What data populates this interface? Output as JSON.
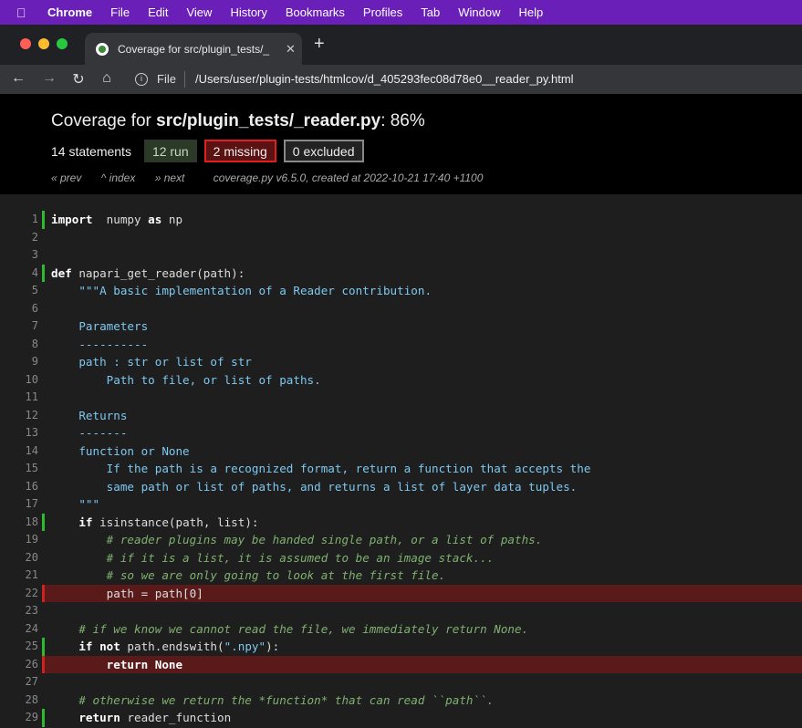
{
  "menubar": {
    "items": [
      "Chrome",
      "File",
      "Edit",
      "View",
      "History",
      "Bookmarks",
      "Profiles",
      "Tab",
      "Window",
      "Help"
    ]
  },
  "tab": {
    "title": "Coverage for src/plugin_tests/_"
  },
  "address": {
    "scheme_label": "File",
    "url": "/Users/user/plugin-tests/htmlcov/d_405293fec08d78e0__reader_py.html"
  },
  "coverage": {
    "title_prefix": "Coverage for ",
    "file": "src/plugin_tests/_reader.py",
    "percent": ": 86%",
    "statements": "14 statements",
    "run": "12 run",
    "missing": "2 missing",
    "excluded": "0 excluded",
    "prev": "« prev",
    "index": "^ index",
    "next": "» next",
    "created": "coverage.py v6.5.0, created at 2022-10-21 17:40 +1100"
  },
  "lines": [
    {
      "n": "1",
      "status": "run",
      "tokens": [
        [
          "kw",
          "import"
        ],
        [
          "",
          "  numpy "
        ],
        [
          "kw",
          "as"
        ],
        [
          "",
          " np"
        ]
      ]
    },
    {
      "n": "2",
      "status": "",
      "tokens": []
    },
    {
      "n": "3",
      "status": "",
      "tokens": []
    },
    {
      "n": "4",
      "status": "run",
      "tokens": [
        [
          "kw",
          "def"
        ],
        [
          "",
          " napari_get_reader(path):"
        ]
      ]
    },
    {
      "n": "5",
      "status": "",
      "tokens": [
        [
          "",
          "    "
        ],
        [
          "str",
          "\"\"\"A basic implementation of a Reader contribution."
        ]
      ]
    },
    {
      "n": "6",
      "status": "",
      "tokens": []
    },
    {
      "n": "7",
      "status": "",
      "tokens": [
        [
          "str",
          "    Parameters"
        ]
      ]
    },
    {
      "n": "8",
      "status": "",
      "tokens": [
        [
          "str",
          "    ----------"
        ]
      ]
    },
    {
      "n": "9",
      "status": "",
      "tokens": [
        [
          "str",
          "    path : str or list of str"
        ]
      ]
    },
    {
      "n": "10",
      "status": "",
      "tokens": [
        [
          "str",
          "        Path to file, or list of paths."
        ]
      ]
    },
    {
      "n": "11",
      "status": "",
      "tokens": []
    },
    {
      "n": "12",
      "status": "",
      "tokens": [
        [
          "str",
          "    Returns"
        ]
      ]
    },
    {
      "n": "13",
      "status": "",
      "tokens": [
        [
          "str",
          "    -------"
        ]
      ]
    },
    {
      "n": "14",
      "status": "",
      "tokens": [
        [
          "str",
          "    function or None"
        ]
      ]
    },
    {
      "n": "15",
      "status": "",
      "tokens": [
        [
          "str",
          "        If the path is a recognized format, return a function that accepts the"
        ]
      ]
    },
    {
      "n": "16",
      "status": "",
      "tokens": [
        [
          "str",
          "        same path or list of paths, and returns a list of layer data tuples."
        ]
      ]
    },
    {
      "n": "17",
      "status": "",
      "tokens": [
        [
          "str",
          "    \"\"\""
        ]
      ]
    },
    {
      "n": "18",
      "status": "run",
      "tokens": [
        [
          "",
          "    "
        ],
        [
          "kw",
          "if"
        ],
        [
          "",
          " isinstance(path, list):"
        ]
      ]
    },
    {
      "n": "19",
      "status": "",
      "tokens": [
        [
          "com",
          "        # reader plugins may be handed single path, or a list of paths."
        ]
      ]
    },
    {
      "n": "20",
      "status": "",
      "tokens": [
        [
          "com",
          "        # if it is a list, it is assumed to be an image stack..."
        ]
      ]
    },
    {
      "n": "21",
      "status": "",
      "tokens": [
        [
          "com",
          "        # so we are only going to look at the first file."
        ]
      ]
    },
    {
      "n": "22",
      "status": "mis",
      "tokens": [
        [
          "",
          "        path = path[0]"
        ]
      ]
    },
    {
      "n": "23",
      "status": "",
      "tokens": []
    },
    {
      "n": "24",
      "status": "",
      "tokens": [
        [
          "com",
          "    # if we know we cannot read the file, we immediately return None."
        ]
      ]
    },
    {
      "n": "25",
      "status": "run",
      "tokens": [
        [
          "",
          "    "
        ],
        [
          "kw",
          "if not"
        ],
        [
          "",
          " path.endswith("
        ],
        [
          "str",
          "\".npy\""
        ],
        [
          "",
          "):"
        ]
      ]
    },
    {
      "n": "26",
      "status": "mis",
      "tokens": [
        [
          "",
          "        "
        ],
        [
          "kw",
          "return None"
        ]
      ]
    },
    {
      "n": "27",
      "status": "",
      "tokens": []
    },
    {
      "n": "28",
      "status": "",
      "tokens": [
        [
          "com",
          "    # otherwise we return the *function* that can read ``path``."
        ]
      ]
    },
    {
      "n": "29",
      "status": "run",
      "tokens": [
        [
          "",
          "    "
        ],
        [
          "kw",
          "return"
        ],
        [
          "",
          " reader_function"
        ]
      ]
    }
  ]
}
